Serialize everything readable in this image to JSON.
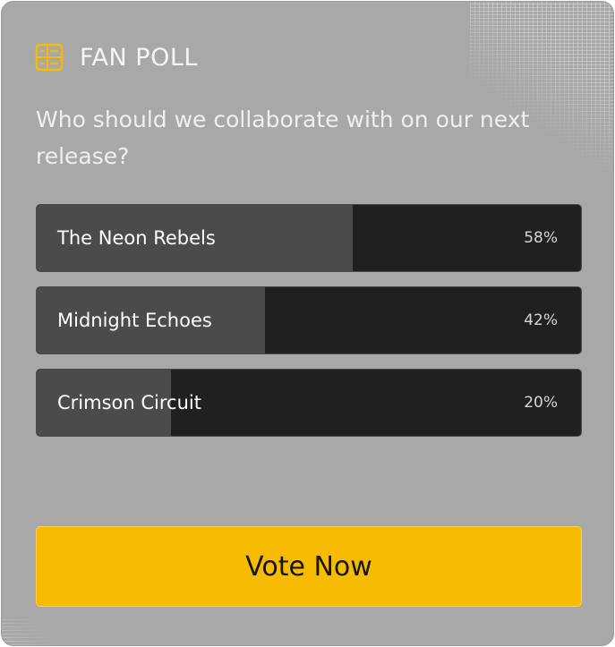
{
  "poll": {
    "title": "FAN POLL",
    "icon": "poll-list-icon",
    "question": "Who should we collaborate with on our next release?",
    "options": [
      {
        "label": "The Neon Rebels",
        "percent_label": "58%",
        "fill_fraction": 0.58
      },
      {
        "label": "Midnight Echoes",
        "percent_label": "42%",
        "fill_fraction": 0.42
      },
      {
        "label": "Crimson Circuit",
        "percent_label": "20%",
        "fill_fraction": 0.246
      }
    ],
    "vote_label": "Vote Now"
  },
  "colors": {
    "accent": "#f7bb02",
    "card_bg": "#a8a8a8",
    "bar_bg": "#202020",
    "bar_fill": "#4b4b4b"
  }
}
